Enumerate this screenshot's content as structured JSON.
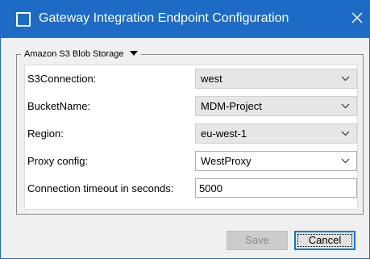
{
  "window": {
    "title": "Gateway Integration Endpoint Configuration"
  },
  "group": {
    "label": "Amazon S3 Blob Storage"
  },
  "fields": {
    "s3connection": {
      "label": "S3Connection:",
      "value": "west"
    },
    "bucketname": {
      "label": "BucketName:",
      "value": "MDM-Project"
    },
    "region": {
      "label": "Region:",
      "value": "eu-west-1"
    },
    "proxy": {
      "label": "Proxy config:",
      "value": "WestProxy"
    },
    "timeout": {
      "label": "Connection timeout in seconds:",
      "value": "5000"
    }
  },
  "buttons": {
    "save": "Save",
    "cancel": "Cancel"
  },
  "icons": {
    "window": "window-icon",
    "close": "close-icon",
    "dropdown": "chevron-down-icon",
    "group_toggle": "caret-down-icon"
  },
  "colors": {
    "titlebar": "#1e6bc6",
    "focus_border": "#0078d7",
    "window_bg": "#f0f0f0"
  }
}
